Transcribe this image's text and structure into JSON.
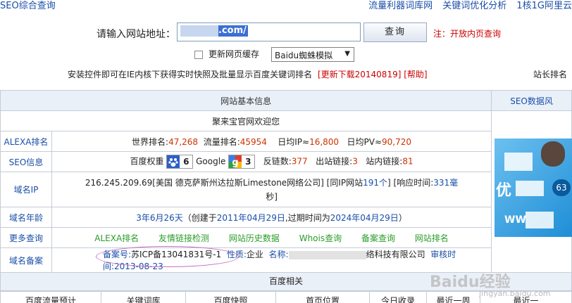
{
  "topbar": {
    "title": "SEO综合查询",
    "links": [
      "流量利器词库网",
      "关键词优化分析",
      "1核1G阿里云"
    ]
  },
  "query": {
    "label": "请输入网站地址：",
    "url_value": ".com/",
    "button": "查询",
    "note": "注：开放内页查询",
    "cache_label": "更新网页缓存",
    "spider_option": "Baidu蜘蛛模拟"
  },
  "notice": {
    "text": "安装控件即可在IE内核下获得实时快照及批量显示百度关键词排名",
    "download": "[更新下载20140819]",
    "help": "[帮助]",
    "rank": "站长排名"
  },
  "table": {
    "section_header": "网站基本信息",
    "seo_data_link": "SEO数据风",
    "welcome": "聚来宝官网欢迎您",
    "rows": {
      "alexa": {
        "label": "ALEXA排名",
        "world_label": "世界排名:",
        "world_value": "47,268",
        "flow_label": "流量排名:",
        "flow_value": "45954",
        "ip_label": "日均IP≈",
        "ip_value": "16,800",
        "pv_label": "日均PV≈",
        "pv_value": "90,720"
      },
      "seo": {
        "label": "SEO信息",
        "baidu_label": "百度权重",
        "baidu_value": "6",
        "google_label": "Google",
        "google_value": "3",
        "backlinks_label": "反链数:",
        "backlinks_value": "377",
        "outlinks_label": "出站链接:",
        "outlinks_value": "3",
        "inlinks_label": "站内链接:",
        "inlinks_value": "81"
      },
      "ip": {
        "label": "域名IP",
        "line1_pre": "216.245.209.69[美国 德克萨斯州达拉斯Limestone网络公司] [同IP网站",
        "same_ip_count": "191个",
        "line1_mid": "] [响应时间:",
        "resp_value": "331毫",
        "line2": "秒]"
      },
      "age": {
        "label": "域名年龄",
        "age": "3年6月26天",
        "created_pre": "（创建于",
        "created_date": "2011年04月29日",
        "expire_pre": ",过期时间为",
        "expire_date": "2024年04月29日",
        "close": "）"
      },
      "more": {
        "label": "更多查询",
        "links": [
          "ALEXA排名",
          "友情链接检测",
          "网站历史数据",
          "Whois查询",
          "备案查询",
          "网站排名"
        ]
      },
      "beian": {
        "label": "域名备案",
        "num_label": "备案号:",
        "num_value": "苏ICP备13041831号-1",
        "nature_label": "性质:",
        "nature_value": "企业",
        "name_label": "名称:",
        "name_value": "络科技有限公司",
        "audit_label": "审核时间:",
        "audit_value": "2013-08-23"
      }
    },
    "baidu_header": "百度相关",
    "bottom_cols": [
      "百度流量预计",
      "关键词库",
      "百度快照",
      "首页位置",
      "今日收录",
      "最近一周",
      "最近一"
    ]
  },
  "ad": {
    "text": "优",
    "url": "WW",
    "badge": "63"
  },
  "watermark": {
    "main": "Baidu经验",
    "sub": "jingyan.baidu.com"
  },
  "colors": {
    "link": "#1a4ea8",
    "red": "#cc3300",
    "green": "#2a9d2a",
    "header_bg": "#eaf0f8"
  }
}
